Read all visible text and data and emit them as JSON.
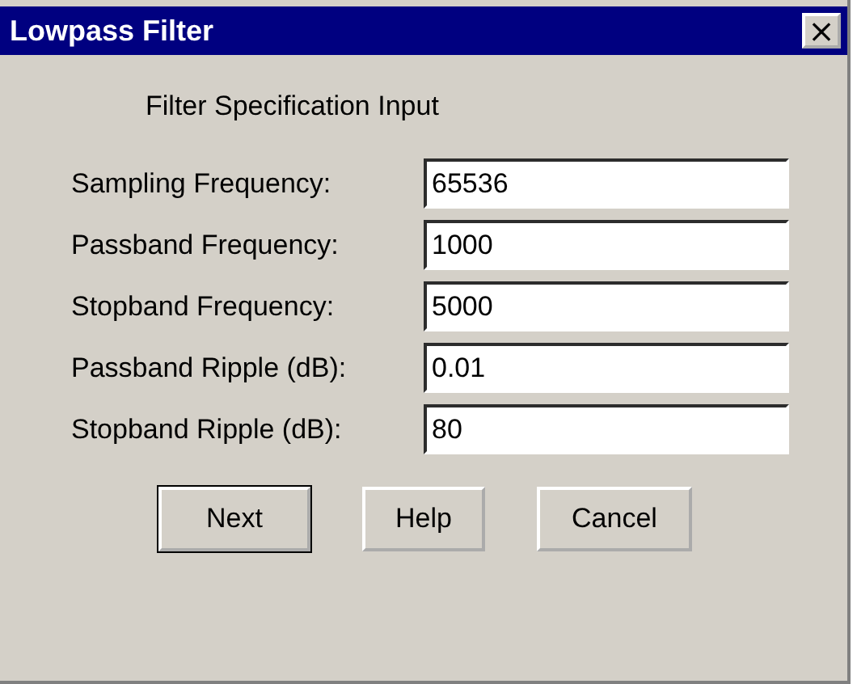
{
  "window": {
    "title": "Lowpass Filter",
    "close": "×"
  },
  "heading": "Filter Specification Input",
  "fields": [
    {
      "label": "Sampling Frequency:",
      "value": "65536"
    },
    {
      "label": "Passband Frequency:",
      "value": "1000"
    },
    {
      "label": "Stopband Frequency:",
      "value": "5000"
    },
    {
      "label": "Passband Ripple (dB):",
      "value": "0.01"
    },
    {
      "label": "Stopband Ripple (dB):",
      "value": "80"
    }
  ],
  "buttons": [
    {
      "label": "Next",
      "default": true
    },
    {
      "label": "Help",
      "default": false
    },
    {
      "label": "Cancel",
      "default": false
    }
  ]
}
